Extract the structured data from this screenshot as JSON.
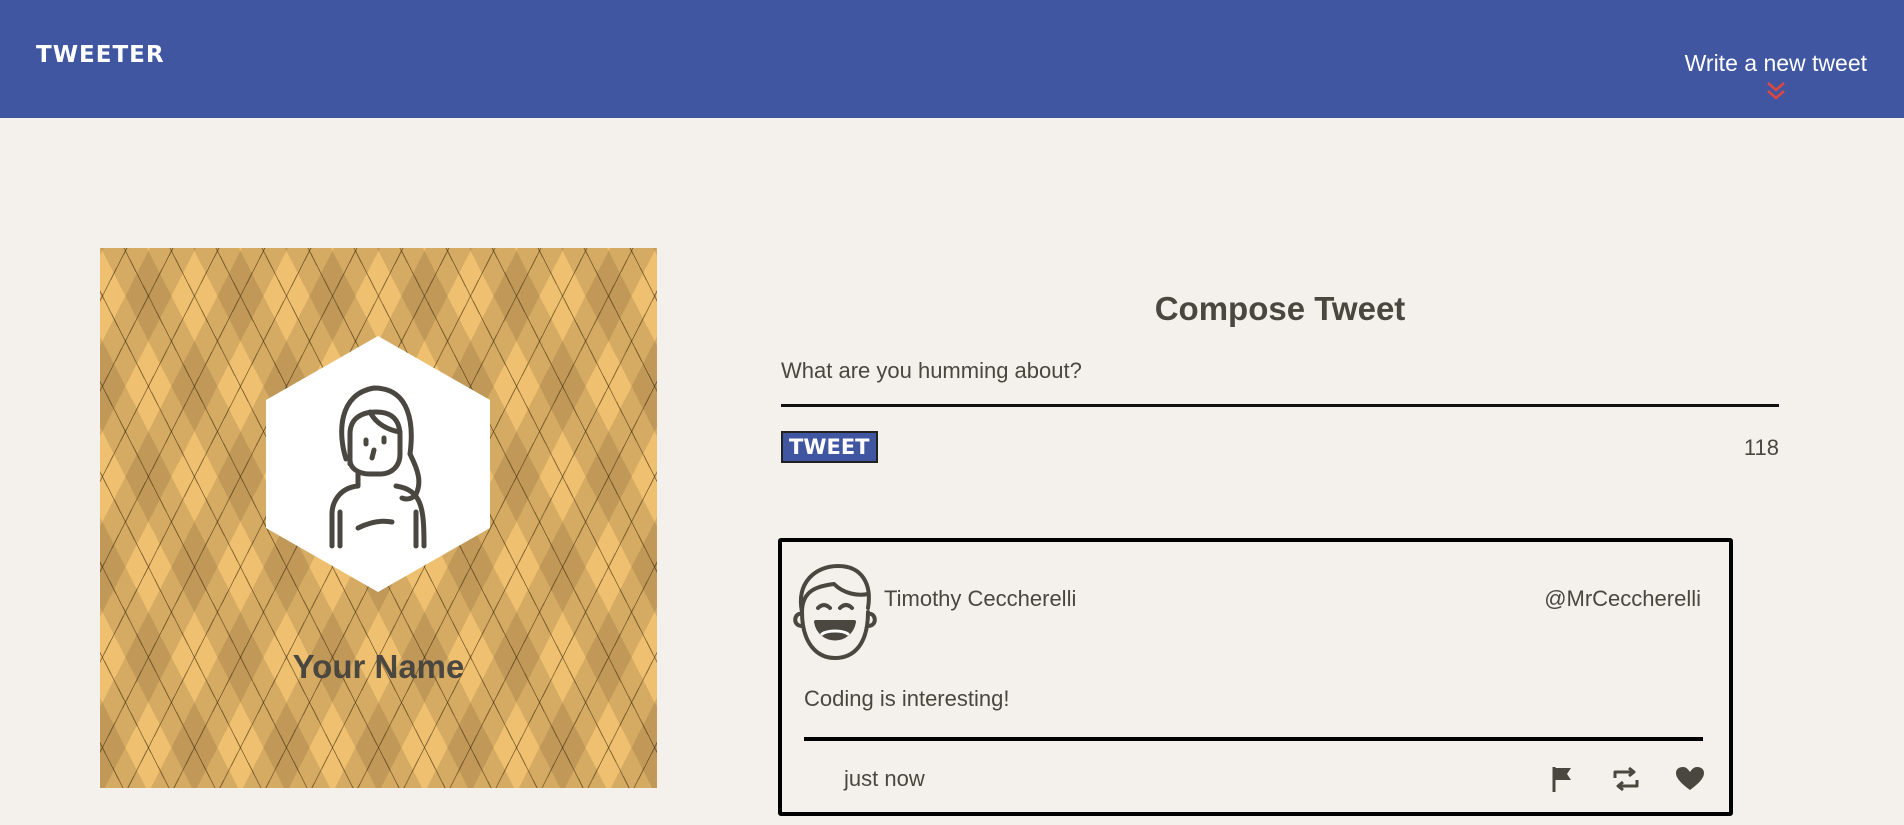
{
  "navbar": {
    "logo": "TWEETER",
    "write_label": "Write a new tweet",
    "arrow_icon": "double-chevron-down-icon",
    "bg_color": "#4056a1",
    "arrow_color": "#e0473f"
  },
  "profile": {
    "name": "Your Name",
    "avatar_icon": "girl-avatar-icon"
  },
  "compose": {
    "title": "Compose Tweet",
    "placeholder": "What are you humming about?",
    "value": "",
    "button_label": "TWEET",
    "counter": "118"
  },
  "tweets": [
    {
      "author": "Timothy Ceccherelli",
      "handle": "@MrCeccherelli",
      "body": "Coding is interesting!",
      "time": "just now",
      "avatar_icon": "boy-avatar-icon",
      "actions": [
        "flag-icon",
        "retweet-icon",
        "heart-icon"
      ]
    }
  ]
}
